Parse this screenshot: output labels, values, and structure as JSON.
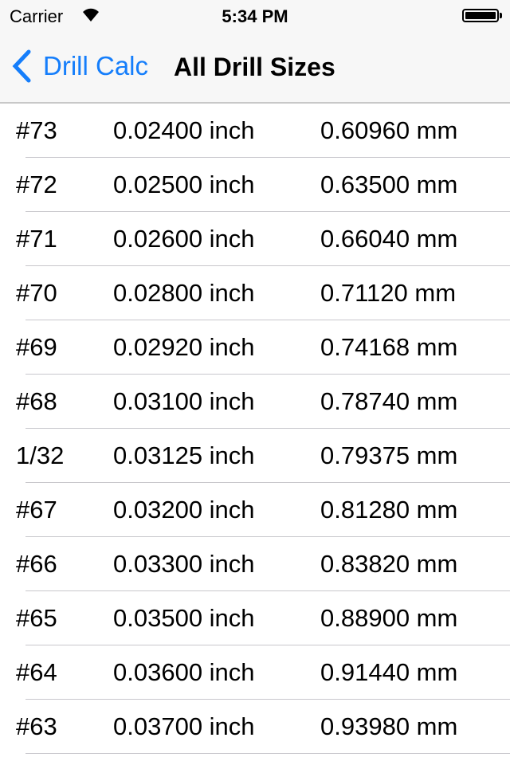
{
  "status": {
    "carrier": "Carrier",
    "time": "5:34 PM",
    "battery_level": 100
  },
  "nav": {
    "back_label": "Drill Calc",
    "title": "All Drill Sizes",
    "accent": "#157efb"
  },
  "rows": [
    [
      "#73",
      "0.02400 inch",
      "0.60960 mm"
    ],
    [
      "#72",
      "0.02500 inch",
      "0.63500 mm"
    ],
    [
      "#71",
      "0.02600 inch",
      "0.66040 mm"
    ],
    [
      "#70",
      "0.02800 inch",
      "0.71120 mm"
    ],
    [
      "#69",
      "0.02920 inch",
      "0.74168 mm"
    ],
    [
      "#68",
      "0.03100 inch",
      "0.78740 mm"
    ],
    [
      "1/32",
      "0.03125 inch",
      "0.79375 mm"
    ],
    [
      "#67",
      "0.03200 inch",
      "0.81280 mm"
    ],
    [
      "#66",
      "0.03300 inch",
      "0.83820 mm"
    ],
    [
      "#65",
      "0.03500 inch",
      "0.88900 mm"
    ],
    [
      "#64",
      "0.03600 inch",
      "0.91440 mm"
    ],
    [
      "#63",
      "0.03700 inch",
      "0.93980 mm"
    ]
  ]
}
